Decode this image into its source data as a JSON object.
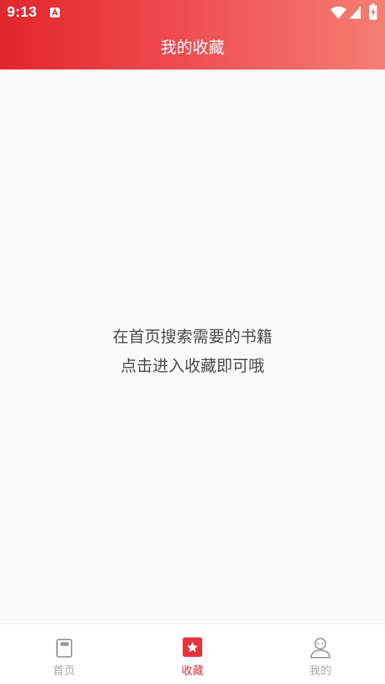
{
  "status_bar": {
    "time": "9:13",
    "icons": [
      "app-notification-icon",
      "wifi-icon",
      "signal-icon",
      "battery-icon"
    ]
  },
  "header": {
    "title": "我的收藏"
  },
  "empty_state": {
    "line1": "在首页搜索需要的书籍",
    "line2": "点击进入收藏即可哦"
  },
  "bottom_nav": {
    "items": [
      {
        "label": "首页",
        "icon": "notebook-icon",
        "active": false
      },
      {
        "label": "收藏",
        "icon": "star-bookmark-icon",
        "active": true
      },
      {
        "label": "我的",
        "icon": "person-icon",
        "active": false
      }
    ]
  },
  "colors": {
    "header_gradient_start": "#e2262c",
    "header_gradient_end": "#f57f72",
    "active": "#e8333a",
    "inactive": "#a8a8a8",
    "background": "#fafafa",
    "message_text": "#4a4a4a"
  }
}
